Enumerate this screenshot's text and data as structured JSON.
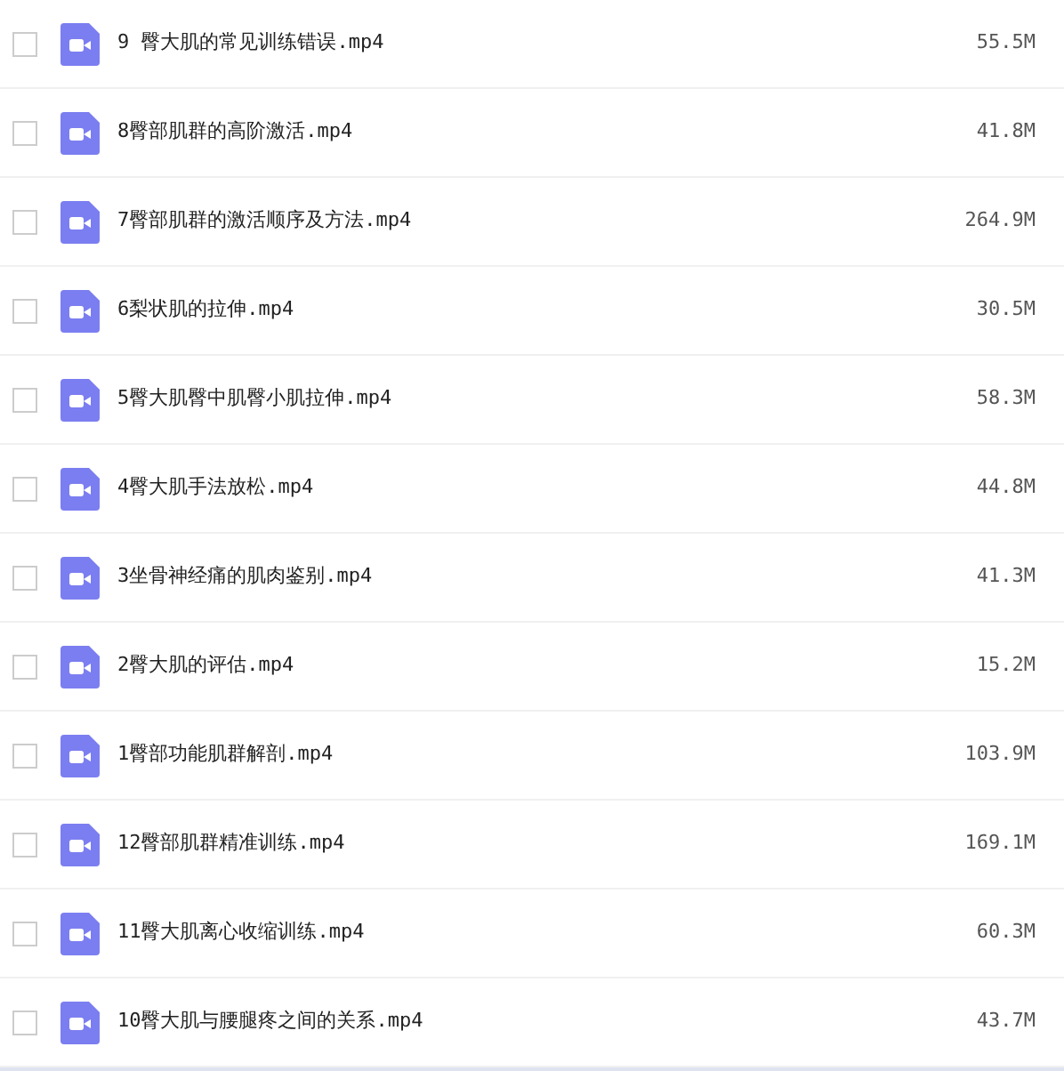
{
  "files": [
    {
      "name": "9 臀大肌的常见训练错误.mp4",
      "size": "55.5M",
      "checked": false
    },
    {
      "name": "8臀部肌群的高阶激活.mp4",
      "size": "41.8M",
      "checked": false
    },
    {
      "name": "7臀部肌群的激活顺序及方法.mp4",
      "size": "264.9M",
      "checked": false
    },
    {
      "name": "6梨状肌的拉伸.mp4",
      "size": "30.5M",
      "checked": false
    },
    {
      "name": "5臀大肌臀中肌臀小肌拉伸.mp4",
      "size": "58.3M",
      "checked": false
    },
    {
      "name": "4臀大肌手法放松.mp4",
      "size": "44.8M",
      "checked": false
    },
    {
      "name": "3坐骨神经痛的肌肉鉴别.mp4",
      "size": "41.3M",
      "checked": false
    },
    {
      "name": "2臀大肌的评估.mp4",
      "size": "15.2M",
      "checked": false
    },
    {
      "name": "1臀部功能肌群解剖.mp4",
      "size": "103.9M",
      "checked": false
    },
    {
      "name": "12臀部肌群精准训练.mp4",
      "size": "169.1M",
      "checked": false
    },
    {
      "name": "11臀大肌离心收缩训练.mp4",
      "size": "60.3M",
      "checked": false
    },
    {
      "name": "10臀大肌与腰腿疼之间的关系.mp4",
      "size": "43.7M",
      "checked": false
    }
  ]
}
